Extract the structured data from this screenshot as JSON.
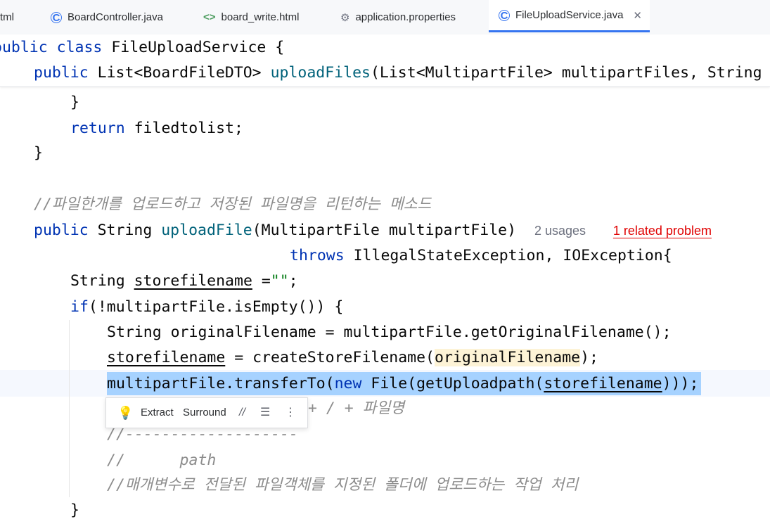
{
  "tabs": [
    {
      "label": "tml",
      "icon": "html-icon"
    },
    {
      "label": "BoardController.java",
      "icon": "class-icon"
    },
    {
      "label": "board_write.html",
      "icon": "html-icon"
    },
    {
      "label": "application.properties",
      "icon": "gear-icon"
    },
    {
      "label": "FileUploadService.java",
      "icon": "class-icon",
      "active": true
    }
  ],
  "sticky": {
    "line1": {
      "kw1": "public",
      "kw2": "class",
      "name": "FileUploadService {"
    },
    "line2": {
      "kw": "public",
      "type": "List<BoardFileDTO>",
      "fn": "uploadFiles",
      "rest": "(List<MultipartFile> multipartFiles, String"
    }
  },
  "code": {
    "l1": "}",
    "l2_kw": "return",
    "l2_rest": " filedtolist;",
    "l3": "}",
    "comment1": "//파일한개를 업로드하고 저장된 파일명을 리턴하는 메소드",
    "sig_kw": "public",
    "sig_type": " String ",
    "sig_fn": "uploadFile",
    "sig_rest": "(MultipartFile multipartFile)",
    "usages": "2 usages",
    "problem": "1 related problem",
    "throws_kw": "throws",
    "throws_rest": " IllegalStateException, IOException{",
    "decl_type": "String ",
    "decl_var": "storefilename",
    "decl_eq": " =",
    "decl_str": "\"\"",
    "decl_end": ";",
    "if_kw": "if",
    "if_rest": "(!multipartFile.isEmpty()) {",
    "orig_line": "String originalFilename = multipartFile.getOriginalFilename();",
    "store_var": "storefilename",
    "store_mid": " = createStoreFilename(",
    "store_arg": "originalFilename",
    "store_end": ");",
    "transfer_pre": "multipartFile.transferTo(",
    "transfer_new": "new",
    "transfer_mid": " File(getUploadpath(",
    "transfer_var": "storefilename",
    "transfer_end": ")));",
    "hidden_comment_tail": "+ / + 파일명",
    "comment_dash": "//-------------------",
    "comment_path": "//      path",
    "comment_desc": "//매개변수로 전달된 파일객체를 지정된 폴더에 업로드하는 작업 처리",
    "close_brace": "}"
  },
  "popup": {
    "extract": "Extract",
    "surround": "Surround"
  }
}
